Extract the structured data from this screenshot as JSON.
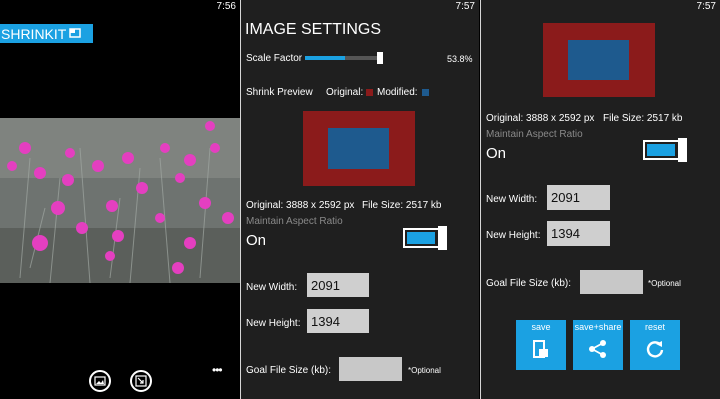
{
  "status": {
    "time_1": "7:56",
    "time_2": "7:57",
    "time_3": "7:57"
  },
  "panel1": {
    "app_title": "SHRINKIT",
    "more_dots": "•••"
  },
  "settings": {
    "title": "IMAGE SETTINGS",
    "scale_label": "Scale Factor",
    "scale_value": "53.8%",
    "scale_fraction": 0.538,
    "preview_label": "Shrink Preview",
    "original_legend": "Original:",
    "modified_legend": "Modified:",
    "original_info": "Original: 3888 x 2592 px",
    "file_size": "File Size: 2517 kb",
    "aspect_label": "Maintain Aspect Ratio",
    "aspect_state": "On",
    "width_label": "New Width:",
    "width_value": "2091",
    "height_label": "New Height:",
    "height_value": "1394",
    "goal_label": "Goal File Size (kb):",
    "goal_value": "",
    "optional_note": "*Optional"
  },
  "actions": {
    "save": "save",
    "save_share": "save+share",
    "reset": "reset"
  },
  "colors": {
    "accent": "#1ba1e2",
    "original": "#8b1b1b",
    "modified": "#1e5a8e"
  }
}
